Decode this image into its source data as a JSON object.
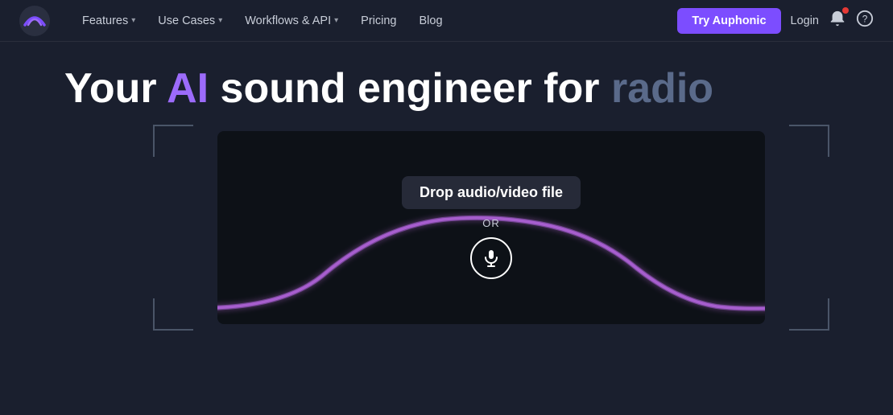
{
  "navbar": {
    "logo_alt": "Auphonic logo",
    "nav_items": [
      {
        "label": "Features",
        "has_dropdown": true
      },
      {
        "label": "Use Cases",
        "has_dropdown": true
      },
      {
        "label": "Workflows & API",
        "has_dropdown": true
      },
      {
        "label": "Pricing",
        "has_dropdown": false
      },
      {
        "label": "Blog",
        "has_dropdown": false
      }
    ],
    "try_button_label": "Try Auphonic",
    "login_label": "Login",
    "notification_badge": true
  },
  "hero": {
    "title_part1": "Your ",
    "title_ai": "AI",
    "title_part2": " sound engineer for ",
    "title_radio": "radio"
  },
  "demo": {
    "drop_label": "Drop audio/video file",
    "or_text": "OR",
    "mic_icon": "🎙"
  }
}
